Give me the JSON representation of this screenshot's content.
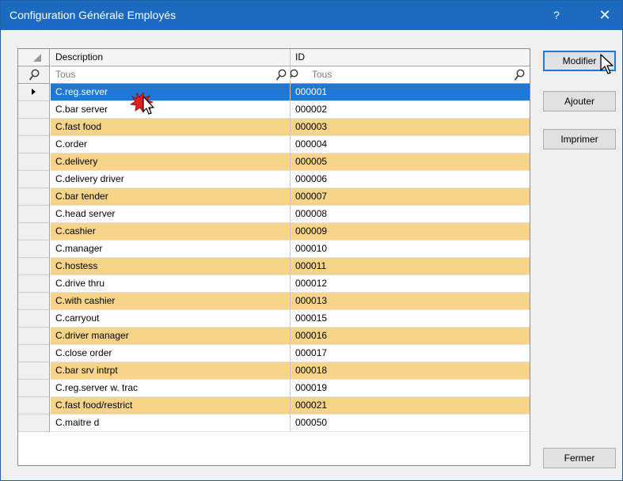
{
  "window": {
    "title": "Configuration Générale Employés",
    "help_label": "?",
    "close_label": "✕"
  },
  "grid": {
    "columns": {
      "description": "Description",
      "id": "ID"
    },
    "filters": {
      "description": "Tous",
      "id": "Tous"
    },
    "selected_index": 0,
    "rows": [
      {
        "description": "C.reg.server",
        "id": "000001"
      },
      {
        "description": "C.bar server",
        "id": "000002"
      },
      {
        "description": "C.fast food",
        "id": "000003"
      },
      {
        "description": "C.order",
        "id": "000004"
      },
      {
        "description": "C.delivery",
        "id": "000005"
      },
      {
        "description": "C.delivery driver",
        "id": "000006"
      },
      {
        "description": "C.bar tender",
        "id": "000007"
      },
      {
        "description": "C.head server",
        "id": "000008"
      },
      {
        "description": "C.cashier",
        "id": "000009"
      },
      {
        "description": "C.manager",
        "id": "000010"
      },
      {
        "description": "C.hostess",
        "id": "000011"
      },
      {
        "description": "C.drive thru",
        "id": "000012"
      },
      {
        "description": "C.with cashier",
        "id": "000013"
      },
      {
        "description": "C.carryout",
        "id": "000015"
      },
      {
        "description": "C.driver manager",
        "id": "000016"
      },
      {
        "description": "C.close order",
        "id": "000017"
      },
      {
        "description": "C.bar srv intrpt",
        "id": "000018"
      },
      {
        "description": "C.reg.server w. trac",
        "id": "000019"
      },
      {
        "description": "C.fast food/restrict",
        "id": "000021"
      },
      {
        "description": "C.maitre d",
        "id": "000050"
      }
    ]
  },
  "buttons": {
    "modifier": "Modifier",
    "ajouter": "Ajouter",
    "imprimer": "Imprimer",
    "fermer": "Fermer"
  },
  "colors": {
    "titlebar": "#1b6ac0",
    "row_alt": "#f6d48a",
    "row_selected": "#1e78d4"
  }
}
